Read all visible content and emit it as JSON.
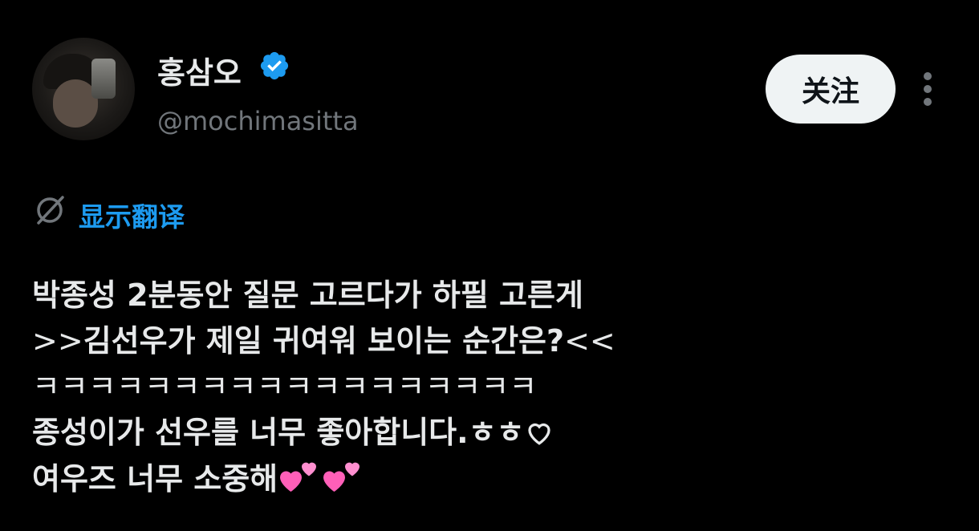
{
  "user": {
    "display_name": "홍삼오",
    "handle": "@mochimasitta"
  },
  "actions": {
    "follow_label": "关注"
  },
  "translate": {
    "label": "显示翻译"
  },
  "tweet": {
    "lines": [
      "박종성 2분동안 질문 고르다가 하필 고른게",
      ">>김선우가 제일 귀여워 보이는 순간은?<<",
      "ㅋㅋㅋㅋㅋㅋㅋㅋㅋㅋㅋㅋㅋㅋㅋㅋㅋㅋ",
      "종성이가 선우를 너무 좋아합니다.ㅎㅎ",
      "여우즈 너무 소중해"
    ],
    "line2_parts": {
      "prefix": ">>",
      "middle": "김선우가 제일 귀여워 보이는 순간은?",
      "suffix": "<<"
    }
  },
  "colors": {
    "background": "#000000",
    "text": "#e7e9ea",
    "secondary": "#71767b",
    "link": "#1d9bf0",
    "verified": "#1d9bf0",
    "heart": "#ff5fb8"
  },
  "icons": [
    "verified-badge-icon",
    "more-options-icon",
    "translate-icon",
    "white-heart-icon",
    "two-hearts-emoji"
  ]
}
